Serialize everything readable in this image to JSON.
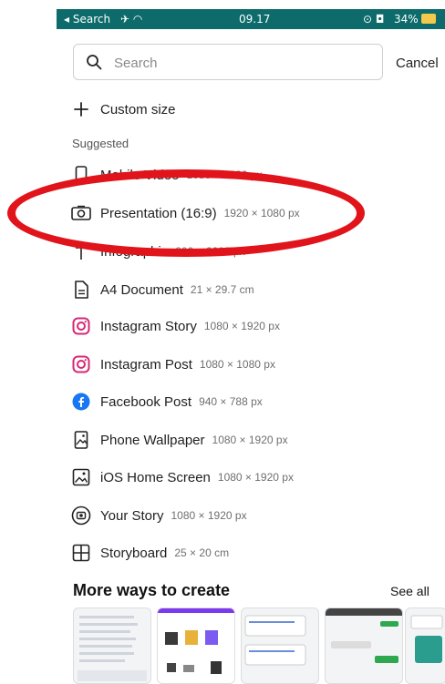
{
  "status_bar": {
    "back_label": "◂ Search",
    "time": "09.17",
    "battery": "34%"
  },
  "search": {
    "placeholder": "Search",
    "cancel_label": "Cancel"
  },
  "custom_size_label": "Custom size",
  "suggested_label": "Suggested",
  "items": [
    {
      "icon": "phone-icon",
      "label": "Mobile Video",
      "dims": "1080 × 1920 px"
    },
    {
      "icon": "presentation-icon",
      "label": "Presentation (16:9)",
      "dims": "1920 × 1080 px"
    },
    {
      "icon": "infographic-icon",
      "label": "Infographic",
      "dims": "800 × 2000 px"
    },
    {
      "icon": "document-icon",
      "label": "A4 Document",
      "dims": "21 × 29.7 cm"
    },
    {
      "icon": "instagram-icon",
      "label": "Instagram Story",
      "dims": "1080 × 1920 px"
    },
    {
      "icon": "instagram-icon",
      "label": "Instagram Post",
      "dims": "1080 × 1080 px"
    },
    {
      "icon": "facebook-icon",
      "label": "Facebook Post",
      "dims": "940 × 788 px"
    },
    {
      "icon": "wallpaper-icon",
      "label": "Phone Wallpaper",
      "dims": "1080 × 1920 px"
    },
    {
      "icon": "image-icon",
      "label": "iOS Home Screen",
      "dims": "1080 × 1920 px"
    },
    {
      "icon": "story-icon",
      "label": "Your Story",
      "dims": "1080 × 1920 px"
    },
    {
      "icon": "storyboard-icon",
      "label": "Storyboard",
      "dims": "25 × 20 cm"
    }
  ],
  "more_ways": {
    "title": "More ways to create",
    "see_all": "See all"
  },
  "colors": {
    "status_bar": "#0d6b6b",
    "highlight": "#e0141a",
    "instagram": "#d62976",
    "facebook": "#1877f2"
  }
}
